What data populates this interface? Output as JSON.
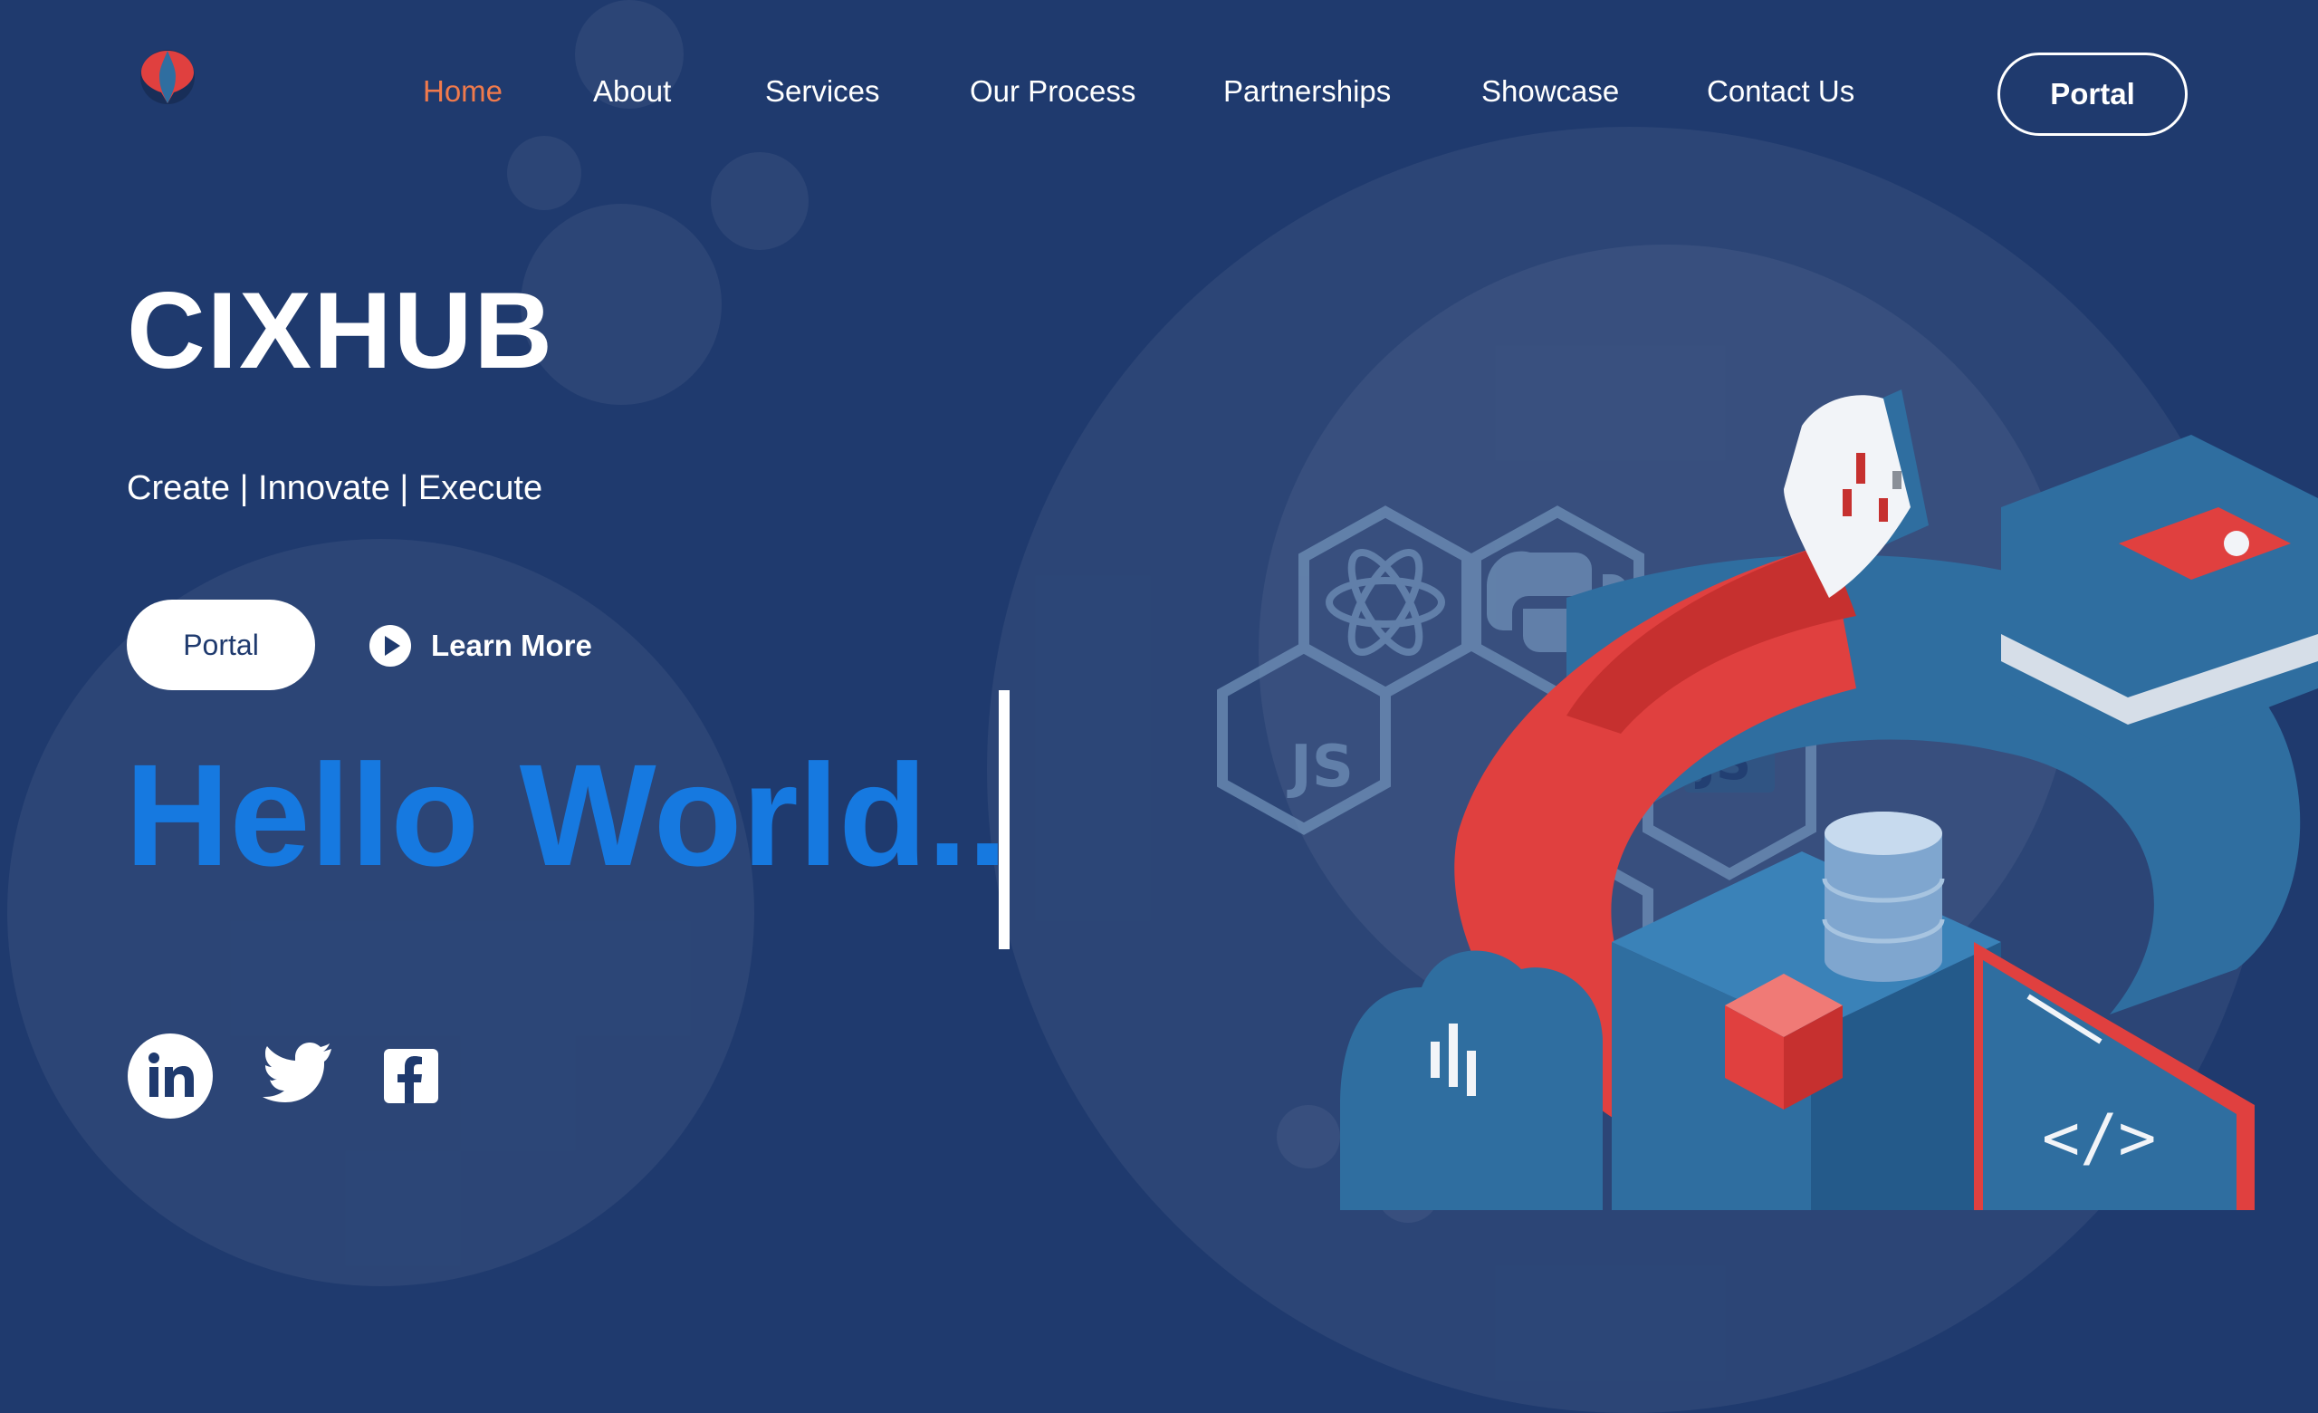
{
  "nav": {
    "items": [
      {
        "label": "Home",
        "active": true
      },
      {
        "label": "About"
      },
      {
        "label": "Services"
      },
      {
        "label": "Our Process"
      },
      {
        "label": "Partnerships"
      },
      {
        "label": "Showcase"
      },
      {
        "label": "Contact Us"
      }
    ],
    "portal_label": "Portal"
  },
  "hero": {
    "title": "CIXHUB",
    "tagline": "Create | Innovate | Execute",
    "portal_label": "Portal",
    "learn_more_label": "Learn More",
    "typing_text": "Hello World.."
  },
  "social": {
    "icons": [
      "linkedin-icon",
      "twitter-icon",
      "facebook-icon"
    ]
  },
  "colors": {
    "background": "#1f3a6e",
    "accent": "#f07a4c",
    "typing_text": "#1679e0",
    "illustration_red": "#e0403f",
    "illustration_blue": "#2f6ea0"
  }
}
